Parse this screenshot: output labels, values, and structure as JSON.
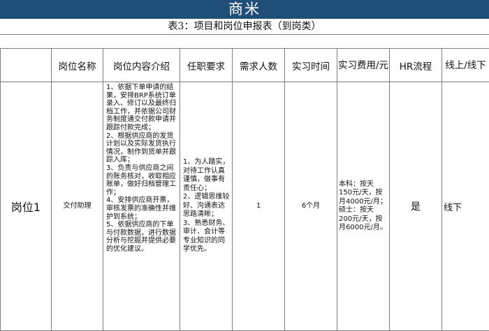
{
  "company": "商米",
  "table_title": "表3：项目和岗位申报表（到岗类）",
  "headers": {
    "col0": "",
    "col1": "岗位名称",
    "col2": "岗位内容介绍",
    "col3": "任职要求",
    "col4": "需求人数",
    "col5": "实习时间",
    "col6": "实习费用/元",
    "col7": "HR流程",
    "col8": "线上/线下"
  },
  "row": {
    "label": "岗位1",
    "position": "交付助理",
    "duties": "1、依据下单申请的结果，安排BRP系统订单录入、修订以及最终归档工作，并依据公司财务制度通交付款申请并跟踪付款完成；\n2、根据供应商的发货计划以及实际发货执行情况，制作到货单并跟踪入库；\n3、负责与供应商之间的账务核对，收取相应账单，做好归档管理工作；\n4、安排供应商开票，审核发票的准确性并维护到系统；\n5、依据供应商的下单与付款数据，进行数据分析与挖掘并提供必要的优化建议。",
    "requirements": "1、为人踏实，对待工作认真谨慎，做事有责任心；\n2、逻辑思维较好、沟通表达思路清晰；\n3、熟悉财务、审计、会计等专业知识的同学优先。",
    "headcount": "1",
    "duration": "6个月",
    "fee": "本科：按天150元/天，按月4000元/月；\n硕士：按天200元/天，按月6000元/月。",
    "hr_process": "是",
    "mode": "线下"
  },
  "colors": {
    "company_bar": "#1f4e79",
    "grid": "#7f7f7f"
  }
}
